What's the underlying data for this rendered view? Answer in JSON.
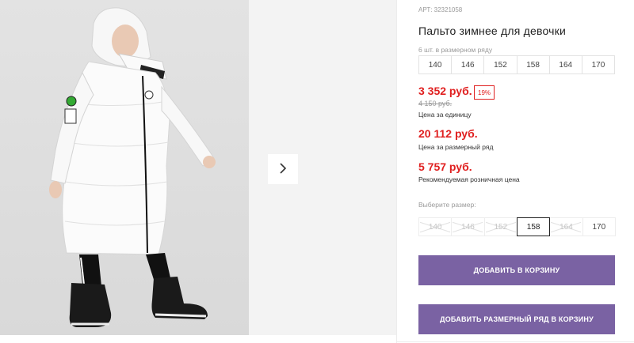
{
  "product": {
    "article": "АРТ: 32321058",
    "title": "Пальто зимнее для девочки",
    "pack_hint": "6 шт. в размерном ряду",
    "pack_sizes": [
      "140",
      "146",
      "152",
      "158",
      "164",
      "170"
    ],
    "price": "3 352 руб.",
    "discount": "19%",
    "old_price": "4 150 руб.",
    "price_label": "Цена за единицу",
    "pack_price": "20 112 руб.",
    "pack_price_label": "Цена за размерный ряд",
    "retail_price": "5 757 руб.",
    "retail_price_label": "Рекомендуемая розничная цена",
    "select_size_label": "Выберите размер:",
    "size_options": [
      {
        "label": "140",
        "state": "disabled"
      },
      {
        "label": "146",
        "state": "disabled"
      },
      {
        "label": "152",
        "state": "disabled"
      },
      {
        "label": "158",
        "state": "selected"
      },
      {
        "label": "164",
        "state": "disabled"
      },
      {
        "label": "170",
        "state": "available"
      }
    ],
    "add_to_cart": "ДОБАВИТЬ В КОРЗИНУ",
    "add_pack_to_cart": "ДОБАВИТЬ РАЗМЕРНЫЙ РЯД В КОРЗИНУ"
  },
  "gallery": {
    "next_icon": "chevron-right-icon"
  },
  "colors": {
    "accent": "#7a62a3",
    "price_red": "#e02020",
    "muted": "#9a9a9a"
  }
}
